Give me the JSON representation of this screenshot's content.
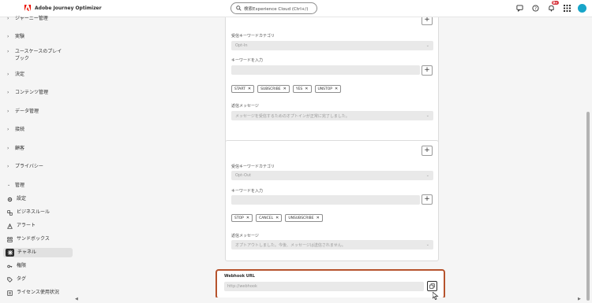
{
  "app": {
    "title": "Adobe Journey Optimizer",
    "brand_color": "#eb1000"
  },
  "search": {
    "placeholder": "検索Experience Cloud (Ctrl+/)"
  },
  "header": {
    "notification_count": "9+"
  },
  "sidebar": {
    "items": [
      {
        "label": "ジャーニー管理",
        "type": "group"
      },
      {
        "label": "実験",
        "type": "group"
      },
      {
        "label": "ユースケースのプレイブック",
        "type": "group"
      },
      {
        "label": "決定",
        "type": "group"
      },
      {
        "label": "コンテンツ管理",
        "type": "group"
      },
      {
        "label": "データ管理",
        "type": "group"
      },
      {
        "label": "接続",
        "type": "group"
      },
      {
        "label": "顧客",
        "type": "group"
      },
      {
        "label": "プライバシー",
        "type": "group"
      },
      {
        "label": "管理",
        "type": "group-open"
      },
      {
        "label": "設定",
        "icon": "gear-icon"
      },
      {
        "label": "ビジネスルール",
        "icon": "business-rules-icon"
      },
      {
        "label": "アラート",
        "icon": "alert-icon"
      },
      {
        "label": "サンドボックス",
        "icon": "sandbox-icon"
      },
      {
        "label": "チャネル",
        "icon": "channel-icon",
        "selected": true
      },
      {
        "label": "権限",
        "icon": "key-icon"
      },
      {
        "label": "タグ",
        "icon": "tag-icon"
      },
      {
        "label": "ライセンス使用状況",
        "icon": "license-icon"
      }
    ]
  },
  "optin_card": {
    "category_label": "受信キーワードカテゴリ",
    "category_value": "Opt-In",
    "keyword_label": "キーワードを入力",
    "tags": [
      "START",
      "SUBSCRIBE",
      "YES",
      "UNSTOP"
    ],
    "reply_label": "返信メッセージ",
    "reply_value": "メッセージを受信するためのオプトインが正常に完了しました。"
  },
  "optout_card": {
    "category_label": "受信キーワードカテゴリ",
    "category_value": "Opt-Out",
    "keyword_label": "キーワードを入力",
    "tags": [
      "STOP",
      "CANCEL",
      "UNSUBSCRIBE"
    ],
    "reply_label": "返信メッセージ",
    "reply_value": "オプトアウトしました。今後、メッセージは送信されません。"
  },
  "webhook": {
    "label": "Webhook URL",
    "value": "http://webhook"
  },
  "colors": {
    "highlight_border": "#b6532d",
    "avatar": "#17a5c9",
    "badge": "#d7373f"
  }
}
